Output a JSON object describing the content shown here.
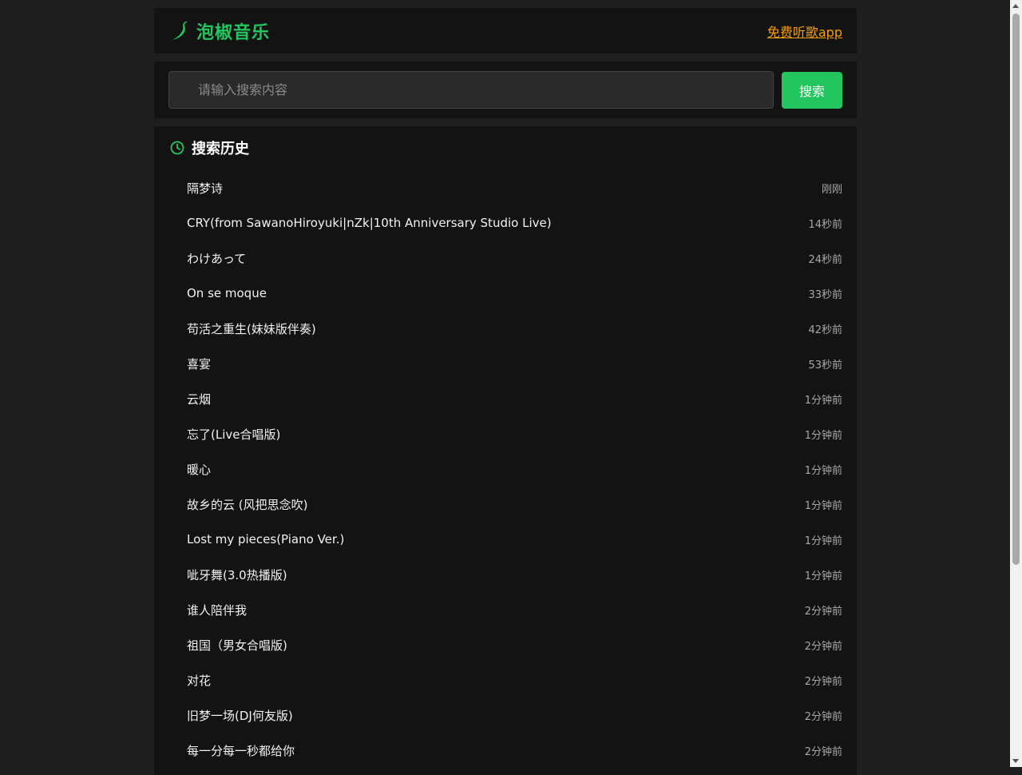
{
  "header": {
    "brand_name": "泡椒音乐",
    "app_link": "免费听歌app",
    "colors": {
      "brand": "#22c55e",
      "link": "#f59e0b"
    },
    "logo_icon": "chili-pepper-icon"
  },
  "search": {
    "placeholder": "请输入搜索内容",
    "value": "",
    "button_label": "搜索"
  },
  "history": {
    "title": "搜索历史",
    "icon": "clock-icon",
    "items": [
      {
        "title": "隔梦诗",
        "time": "刚刚"
      },
      {
        "title": "CRY(from SawanoHiroyuki|nZk|10th Anniversary Studio Live)",
        "time": "14秒前"
      },
      {
        "title": "わけあって",
        "time": "24秒前"
      },
      {
        "title": "On se moque",
        "time": "33秒前"
      },
      {
        "title": "苟活之重生(妹妹版伴奏)",
        "time": "42秒前"
      },
      {
        "title": "喜宴",
        "time": "53秒前"
      },
      {
        "title": "云烟",
        "time": "1分钟前"
      },
      {
        "title": "忘了(Live合唱版)",
        "time": "1分钟前"
      },
      {
        "title": "暖心",
        "time": "1分钟前"
      },
      {
        "title": "故乡的云 (风把思念吹)",
        "time": "1分钟前"
      },
      {
        "title": "Lost my pieces(Piano Ver.)",
        "time": "1分钟前"
      },
      {
        "title": "呲牙舞(3.0热播版)",
        "time": "1分钟前"
      },
      {
        "title": "谁人陪伴我",
        "time": "2分钟前"
      },
      {
        "title": "祖国（男女合唱版)",
        "time": "2分钟前"
      },
      {
        "title": "对花",
        "time": "2分钟前"
      },
      {
        "title": "旧梦一场(DJ何友版)",
        "time": "2分钟前"
      },
      {
        "title": "每一分每一秒都给你",
        "time": "2分钟前"
      }
    ]
  }
}
